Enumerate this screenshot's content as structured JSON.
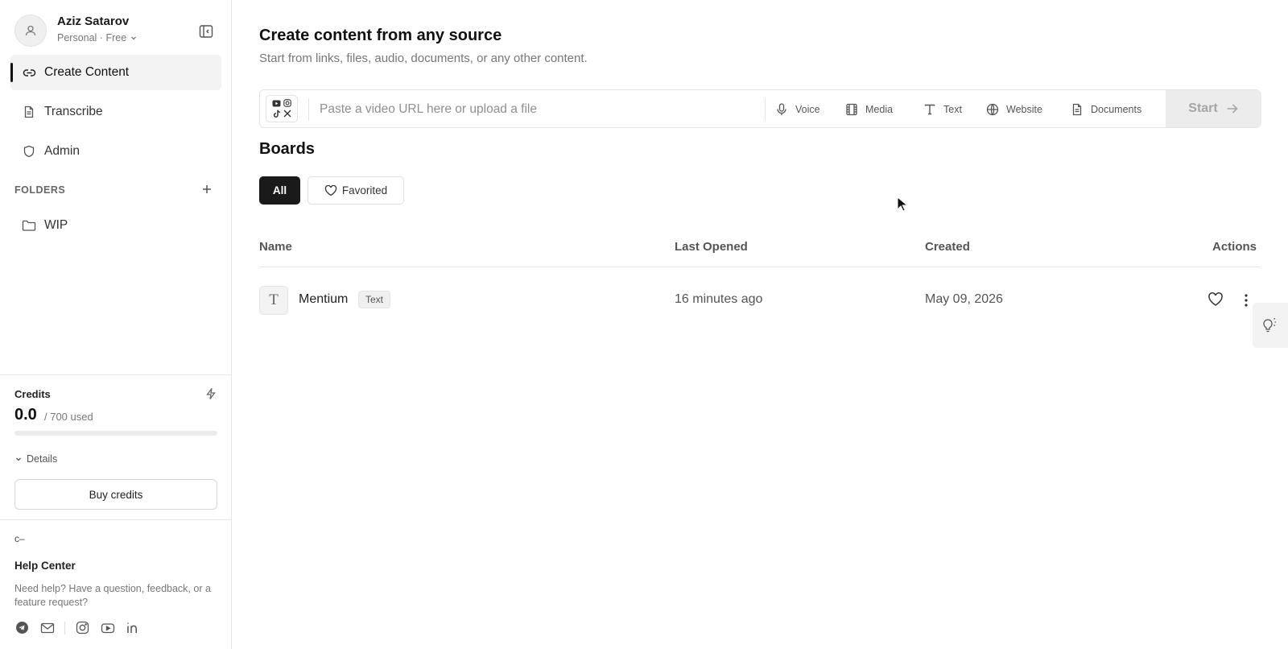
{
  "user": {
    "name": "Aziz Satarov",
    "plan": "Personal · Free"
  },
  "sidebar": {
    "nav": [
      {
        "label": "Create Content",
        "icon": "link-icon",
        "active": true
      },
      {
        "label": "Transcribe",
        "icon": "document-icon",
        "active": false
      },
      {
        "label": "Admin",
        "icon": "shield-icon",
        "active": false
      }
    ],
    "folders_label": "FOLDERS",
    "folders": [
      {
        "label": "WIP",
        "icon": "folder-icon"
      }
    ]
  },
  "credits": {
    "title": "Credits",
    "value": "0.0",
    "used_text": "/ 700 used",
    "fraction_used": 0.0,
    "details_label": "Details",
    "buy_label": "Buy credits"
  },
  "help": {
    "logo": "c–",
    "title": "Help Center",
    "description": "Need help? Have a question, feedback, or a feature request?",
    "socials": [
      "telegram-icon",
      "mail-icon",
      "instagram-icon",
      "youtube-icon",
      "linkedin-icon"
    ]
  },
  "main": {
    "title": "Create content from any source",
    "subtitle": "Start from links, files, audio, documents, or any other content.",
    "input_placeholder": "Paste a video URL here or upload a file",
    "sources": [
      {
        "label": "Voice",
        "icon": "microphone-icon"
      },
      {
        "label": "Media",
        "icon": "film-icon"
      },
      {
        "label": "Text",
        "icon": "text-icon"
      },
      {
        "label": "Website",
        "icon": "globe-icon"
      },
      {
        "label": "Documents",
        "icon": "document-icon"
      }
    ],
    "start_label": "Start"
  },
  "boards": {
    "title": "Boards",
    "filters": {
      "all": "All",
      "favorited": "Favorited"
    },
    "columns": {
      "name": "Name",
      "last_opened": "Last Opened",
      "created": "Created",
      "actions": "Actions"
    },
    "rows": [
      {
        "icon_glyph": "T",
        "name": "Mentium",
        "tag": "Text",
        "last_opened": "16 minutes ago",
        "created": "May 09, 2026"
      }
    ]
  },
  "colors": {
    "accent": "#1a1a1a",
    "muted": "#777777",
    "border": "#e7e7e7"
  }
}
